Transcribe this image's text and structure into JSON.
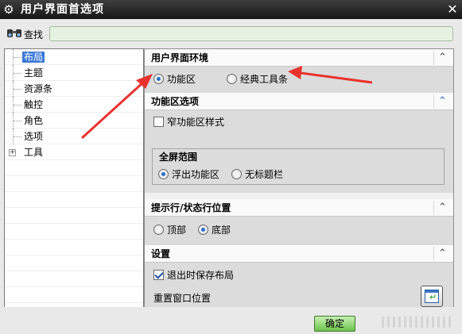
{
  "window": {
    "title": "用户界面首选项",
    "app_icon": "gear-icon",
    "close_icon": "close-icon"
  },
  "search": {
    "label": "查找",
    "value": "",
    "icon": "binoculars-icon"
  },
  "tree": {
    "items": [
      {
        "label": "布局",
        "selected": true
      },
      {
        "label": "主题"
      },
      {
        "label": "资源条"
      },
      {
        "label": "触控"
      },
      {
        "label": "角色"
      },
      {
        "label": "选项"
      },
      {
        "label": "工具",
        "expandable": true
      }
    ]
  },
  "sections": {
    "ui_env": {
      "title": "用户界面环境",
      "options": [
        {
          "label": "功能区",
          "selected": true
        },
        {
          "label": "经典工具条",
          "selected": false
        }
      ]
    },
    "ribbon": {
      "title": "功能区选项",
      "narrow_style": {
        "label": "窄功能区样式",
        "checked": false
      },
      "fullscreen_group": {
        "label": "全屏范围",
        "options": [
          {
            "label": "浮出功能区",
            "selected": true
          },
          {
            "label": "无标题栏",
            "selected": false
          }
        ]
      }
    },
    "cue_line": {
      "title": "提示行/状态行位置",
      "options": [
        {
          "label": "顶部",
          "selected": false
        },
        {
          "label": "底部",
          "selected": true
        }
      ]
    },
    "settings": {
      "title": "设置",
      "save_layout": {
        "label": "退出时保存布局",
        "checked": true
      },
      "reset_label": "重置窗口位置"
    }
  },
  "footer": {
    "ok_label": "确定"
  },
  "colors": {
    "title_bar": "#1e1e1e",
    "selection": "#3b78d6",
    "ok_button": "#6cc44a",
    "annotation_arrow": "#e8322e"
  }
}
